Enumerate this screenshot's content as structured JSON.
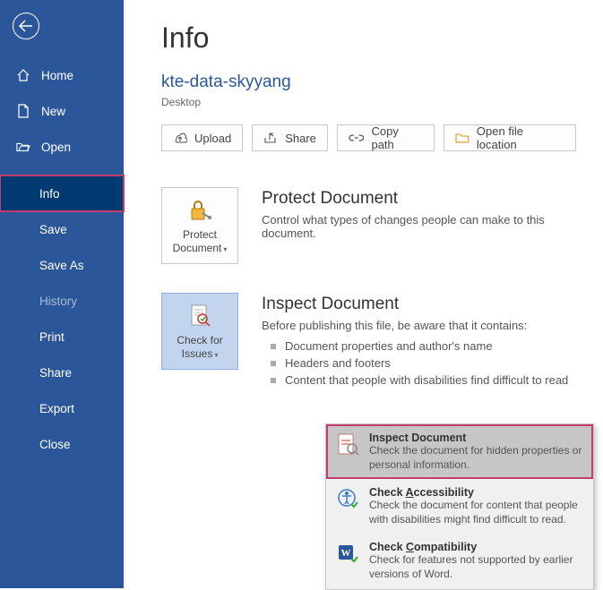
{
  "nav": {
    "home": "Home",
    "new": "New",
    "open": "Open",
    "info": "Info",
    "save": "Save",
    "saveas": "Save As",
    "history": "History",
    "print": "Print",
    "share": "Share",
    "export": "Export",
    "close": "Close"
  },
  "page_title": "Info",
  "doc_name": "kte-data-skyyang",
  "doc_location": "Desktop",
  "actions": {
    "upload": "Upload",
    "share": "Share",
    "copypath": "Copy path",
    "openloc": "Open file location"
  },
  "protect": {
    "btn_line1": "Protect",
    "btn_line2": "Document",
    "title": "Protect Document",
    "desc": "Control what types of changes people can make to this document."
  },
  "inspect": {
    "btn_line1": "Check for",
    "btn_line2": "Issues",
    "title": "Inspect Document",
    "desc": "Before publishing this file, be aware that it contains:",
    "bullets": [
      "Document properties and author's name",
      "Headers and footers",
      "Content that people with disabilities find difficult to read"
    ]
  },
  "dropdown": {
    "inspect_title": "Inspect Document",
    "inspect_desc": "Check the document for hidden properties or personal information.",
    "access_title_pre": "Check ",
    "access_title_uk": "A",
    "access_title_post": "ccessibility",
    "access_desc": "Check the document for content that people with disabilities might find difficult to read.",
    "compat_title_pre": "Check ",
    "compat_title_uk": "C",
    "compat_title_post": "ompatibility",
    "compat_desc": "Check for features not supported by earlier versions of Word."
  }
}
